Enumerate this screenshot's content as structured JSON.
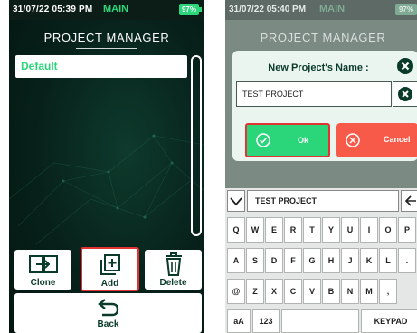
{
  "left_screen": {
    "status": {
      "time": "31/07/22 05:39 PM",
      "mode": "MAIN",
      "battery": "97%"
    },
    "title": "PROJECT MANAGER",
    "projects": [
      "Default"
    ],
    "buttons": {
      "clone": "Clone",
      "add": "Add",
      "delete": "Delete",
      "back": "Back"
    }
  },
  "right_screen": {
    "status": {
      "time": "31/07/22 05:40 PM",
      "mode": "MAIN",
      "battery": "97%"
    },
    "title": "PROJECT MANAGER",
    "dialog": {
      "title": "New Project's Name :",
      "input_value": "TEST PROJECT",
      "ok": "Ok",
      "cancel": "Cancel"
    },
    "keyboard": {
      "input_value": "TEST PROJECT",
      "row1": [
        "Q",
        "W",
        "E",
        "R",
        "T",
        "Y",
        "U",
        "I",
        "O",
        "P"
      ],
      "row2": [
        "A",
        "S",
        "D",
        "F",
        "G",
        "H",
        "J",
        "K",
        "L",
        "."
      ],
      "row3": [
        "@",
        "Z",
        "X",
        "C",
        "V",
        "B",
        "N",
        "M",
        ","
      ],
      "mode_key": "aA",
      "num_key": "123",
      "keypad_key": "KEYPAD"
    }
  },
  "colors": {
    "accent_green": "#2bd67b",
    "highlight_red": "#e33232",
    "cancel_red": "#f85a4a",
    "dark_green": "#0a3a2a"
  }
}
